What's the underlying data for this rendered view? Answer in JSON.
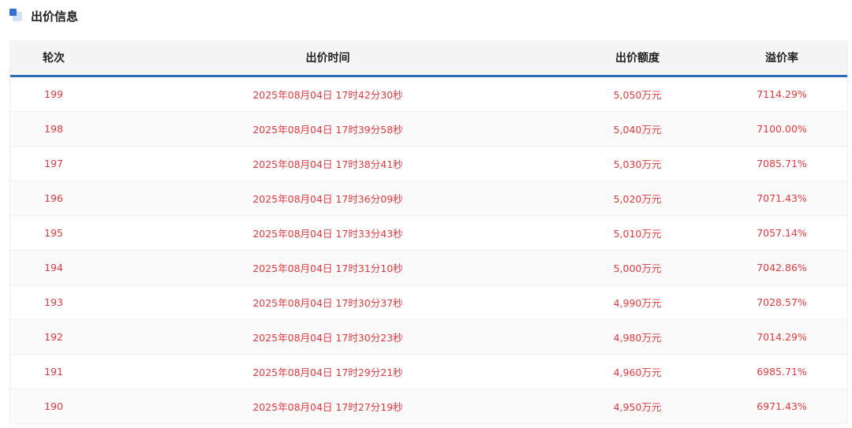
{
  "section": {
    "title": "出价信息",
    "accent_color": "#2f6fd6",
    "icon": "section-squares-icon"
  },
  "table": {
    "header_border_color": "#2a6ebf",
    "text_color": "#e0393e",
    "columns": [
      "轮次",
      "出价时间",
      "出价额度",
      "溢价率"
    ],
    "rows": [
      {
        "round": "199",
        "time": "2025年08月04日 17时42分30秒",
        "amount": "5,050万元",
        "premium": "7114.29%"
      },
      {
        "round": "198",
        "time": "2025年08月04日 17时39分58秒",
        "amount": "5,040万元",
        "premium": "7100.00%"
      },
      {
        "round": "197",
        "time": "2025年08月04日 17时38分41秒",
        "amount": "5,030万元",
        "premium": "7085.71%"
      },
      {
        "round": "196",
        "time": "2025年08月04日 17时36分09秒",
        "amount": "5,020万元",
        "premium": "7071.43%"
      },
      {
        "round": "195",
        "time": "2025年08月04日 17时33分43秒",
        "amount": "5,010万元",
        "premium": "7057.14%"
      },
      {
        "round": "194",
        "time": "2025年08月04日 17时31分10秒",
        "amount": "5,000万元",
        "premium": "7042.86%"
      },
      {
        "round": "193",
        "time": "2025年08月04日 17时30分37秒",
        "amount": "4,990万元",
        "premium": "7028.57%"
      },
      {
        "round": "192",
        "time": "2025年08月04日 17时30分23秒",
        "amount": "4,980万元",
        "premium": "7014.29%"
      },
      {
        "round": "191",
        "time": "2025年08月04日 17时29分21秒",
        "amount": "4,960万元",
        "premium": "6985.71%"
      },
      {
        "round": "190",
        "time": "2025年08月04日 17时27分19秒",
        "amount": "4,950万元",
        "premium": "6971.43%"
      }
    ]
  }
}
